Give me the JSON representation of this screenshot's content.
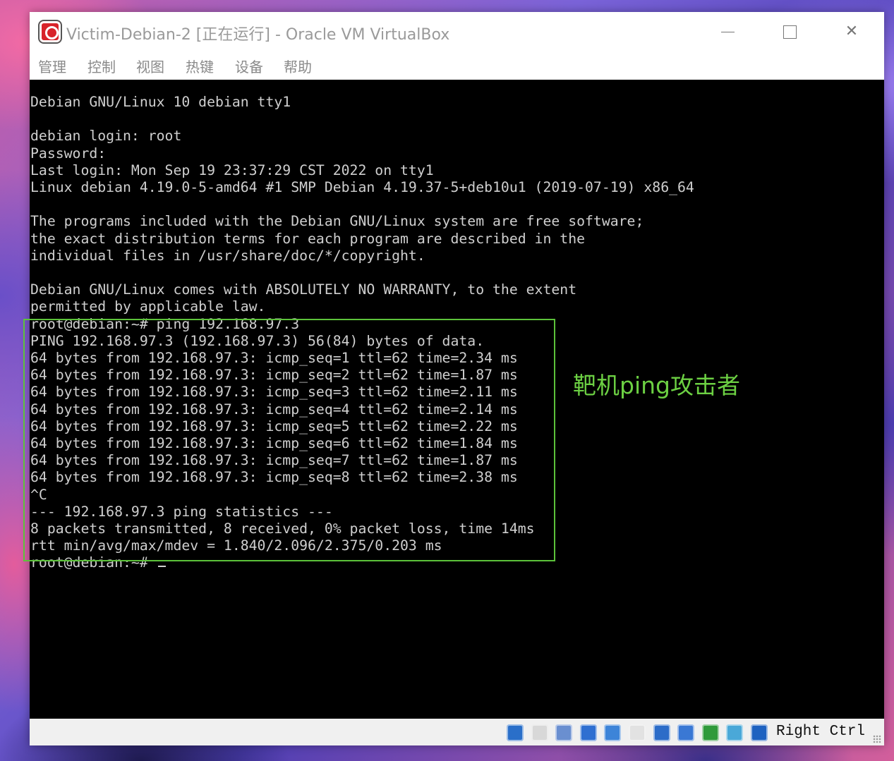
{
  "window": {
    "title": "Victim-Debian-2 [正在运行] - Oracle VM VirtualBox",
    "app_icon": "virtualbox-icon",
    "close_glyph": "✕"
  },
  "menu": {
    "items": [
      "管理",
      "控制",
      "视图",
      "热键",
      "设备",
      "帮助"
    ]
  },
  "terminal": {
    "lines": [
      "Debian GNU/Linux 10 debian tty1",
      "",
      "debian login: root",
      "Password:",
      "Last login: Mon Sep 19 23:37:29 CST 2022 on tty1",
      "Linux debian 4.19.0-5-amd64 #1 SMP Debian 4.19.37-5+deb10u1 (2019-07-19) x86_64",
      "",
      "The programs included with the Debian GNU/Linux system are free software;",
      "the exact distribution terms for each program are described in the",
      "individual files in /usr/share/doc/*/copyright.",
      "",
      "Debian GNU/Linux comes with ABSOLUTELY NO WARRANTY, to the extent",
      "permitted by applicable law.",
      "root@debian:~# ping 192.168.97.3",
      "PING 192.168.97.3 (192.168.97.3) 56(84) bytes of data.",
      "64 bytes from 192.168.97.3: icmp_seq=1 ttl=62 time=2.34 ms",
      "64 bytes from 192.168.97.3: icmp_seq=2 ttl=62 time=1.87 ms",
      "64 bytes from 192.168.97.3: icmp_seq=3 ttl=62 time=2.11 ms",
      "64 bytes from 192.168.97.3: icmp_seq=4 ttl=62 time=2.14 ms",
      "64 bytes from 192.168.97.3: icmp_seq=5 ttl=62 time=2.22 ms",
      "64 bytes from 192.168.97.3: icmp_seq=6 ttl=62 time=1.84 ms",
      "64 bytes from 192.168.97.3: icmp_seq=7 ttl=62 time=1.87 ms",
      "64 bytes from 192.168.97.3: icmp_seq=8 ttl=62 time=2.38 ms",
      "^C",
      "--- 192.168.97.3 ping statistics ---",
      "8 packets transmitted, 8 received, 0% packet loss, time 14ms",
      "rtt min/avg/max/mdev = 1.840/2.096/2.375/0.203 ms"
    ],
    "prompt": "root@debian:~# "
  },
  "annotation": {
    "text": "靶机ping攻击者",
    "color": "#6cd043"
  },
  "statusbar": {
    "host_key": "Right Ctrl",
    "icons": [
      {
        "name": "hard-disk-icon",
        "color": "#2a6fc9"
      },
      {
        "name": "optical-drive-icon",
        "color": "#d8d8d8"
      },
      {
        "name": "audio-icon",
        "color": "#6a8fd0"
      },
      {
        "name": "network-icon",
        "color": "#2f6fd1"
      },
      {
        "name": "usb-icon",
        "color": "#3d84d8"
      },
      {
        "name": "shared-folders-icon",
        "color": "#e2e2e2"
      },
      {
        "name": "display-icon",
        "color": "#2c6cc8"
      },
      {
        "name": "video-capture-icon",
        "color": "#3a78d4"
      },
      {
        "name": "cpu-activity-icon",
        "color": "#2f9a3a"
      },
      {
        "name": "mouse-integration-icon",
        "color": "#4aa8d8"
      },
      {
        "name": "keyboard-capture-icon",
        "color": "#1e62c0"
      }
    ]
  },
  "colors": {
    "terminal_bg": "#000000",
    "terminal_fg": "#cfcfcf",
    "highlight_border": "#5cc23a"
  }
}
